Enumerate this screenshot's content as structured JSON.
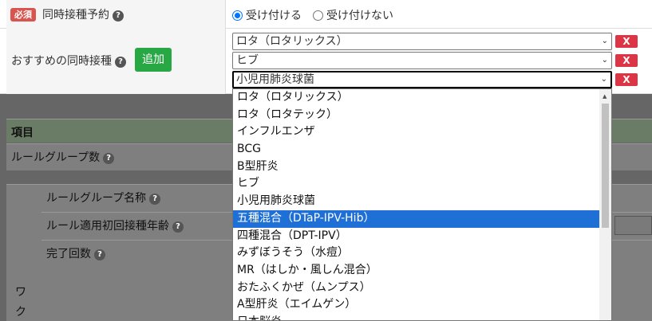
{
  "form": {
    "required_badge": "必須",
    "simultaneous_label": "同時接種予約",
    "accept_label": "受け付ける",
    "reject_label": "受け付けない",
    "recommended_label": "おすすめの同時接種",
    "add_label": "追加",
    "remove_label": "X",
    "selects": [
      {
        "value": "ロタ（ロタリックス）"
      },
      {
        "value": "ヒブ"
      },
      {
        "value": "小児用肺炎球菌"
      }
    ]
  },
  "background": {
    "header": "項目",
    "rule_group_count": "ルールグループ数",
    "rule_group_name": "ルールグループ名称",
    "rule_first_age": "ルール適用初回接種年齢",
    "completion_count": "完了回数",
    "side_chars": [
      "ワ",
      "ク"
    ]
  },
  "dropdown": {
    "options": [
      "ロタ（ロタリックス）",
      "ロタ（ロタテック）",
      "インフルエンザ",
      "BCG",
      "B型肝炎",
      "ヒブ",
      "小児用肺炎球菌",
      "五種混合（DTaP-IPV-Hib）",
      "四種混合（DPT-IPV）",
      "みずぼうそう（水痘）",
      "MR（はしか・風しん混合）",
      "おたふくかぜ（ムンプス）",
      "A型肝炎（エイムゲン）",
      "日本脳炎"
    ],
    "highlighted_index": 7
  },
  "colors": {
    "required": "#d9534f",
    "add": "#28a745",
    "remove": "#dc3545",
    "highlight": "#1e6fd6"
  }
}
